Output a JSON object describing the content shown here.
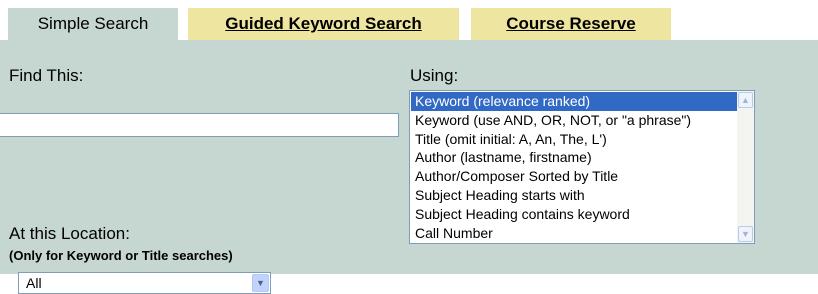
{
  "tabs": [
    {
      "label": "Simple Search",
      "active": true
    },
    {
      "label": "Guided Keyword Search",
      "active": false
    },
    {
      "label": "Course Reserve",
      "active": false
    }
  ],
  "find": {
    "label": "Find This:",
    "value": ""
  },
  "using": {
    "label": "Using:",
    "selected_index": 0,
    "options": [
      "Keyword (relevance ranked)",
      "Keyword (use AND, OR, NOT, or \"a phrase\")",
      "Title (omit initial: A, An, The, L')",
      "Author (lastname, firstname)",
      "Author/Composer Sorted by Title",
      "Subject Heading starts with",
      "Subject Heading contains keyword",
      "Call Number"
    ]
  },
  "location": {
    "label": "At this Location:",
    "note": "(Only for Keyword or Title searches)",
    "value": "All"
  },
  "colors": {
    "panel": "#c6d6d1",
    "inactive_tab": "#eee6a0",
    "selection": "#316ac5"
  },
  "icons": {
    "scroll_up": "scroll-up-arrow",
    "scroll_down": "scroll-down-arrow",
    "dropdown": "chevron-down"
  }
}
